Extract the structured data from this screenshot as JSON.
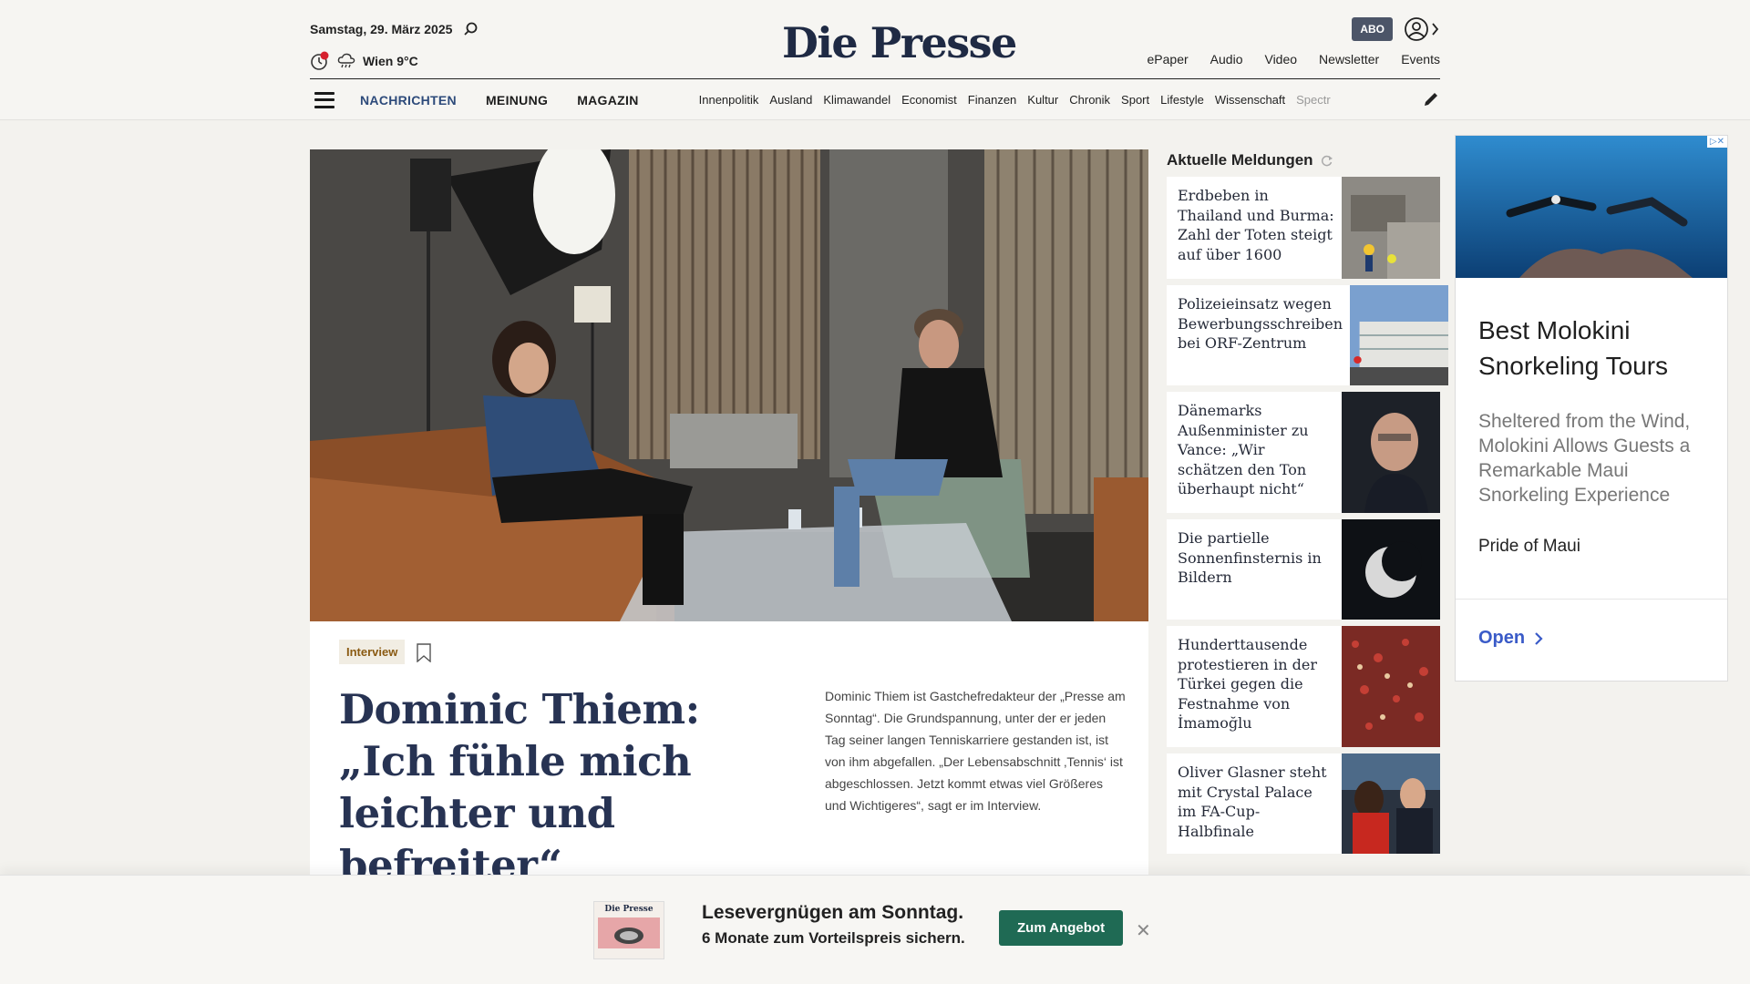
{
  "header": {
    "date": "Samstag, 29. März 2025",
    "weather": "Wien 9°C",
    "logo": "Die Presse",
    "abo": "ABO",
    "links": [
      "ePaper",
      "Audio",
      "Video",
      "Newsletter",
      "Events"
    ],
    "main_nav": [
      "NACHRICHTEN",
      "MEINUNG",
      "MAGAZIN"
    ],
    "sub_nav": [
      "Innenpolitik",
      "Ausland",
      "Klimawandel",
      "Economist",
      "Finanzen",
      "Kultur",
      "Chronik",
      "Sport",
      "Lifestyle",
      "Wissenschaft",
      "Spectr"
    ]
  },
  "hero": {
    "tag": "Interview",
    "headline": "Dominic Thiem: „Ich fühle mich leichter und befreiter“",
    "teaser": "Dominic Thiem ist Gastchefredakteur der „Presse am Sonntag“. Die Grundspannung, unter der er jeden Tag seiner langen Tenniskarriere gestanden ist, ist von ihm abgefallen. „Der Lebensabschnitt ‚Tennis‘ ist abgeschlossen. Jetzt kommt etwas viel Größeres und Wichtigeres“, sagt er im Interview."
  },
  "news": {
    "title": "Aktuelle Meldungen",
    "items": [
      {
        "text": "Erdbeben in Thailand und Burma: Zahl der Toten steigt auf über 1600",
        "image": "earthquake-rescue-photo"
      },
      {
        "text": "Polizeieinsatz wegen Bewerbungsschreiben bei ORF-Zentrum",
        "image": "orf-building-photo"
      },
      {
        "text": "Dänemarks Außenminister zu Vance: „Wir schätzen den Ton überhaupt nicht“",
        "image": "minister-portrait-photo"
      },
      {
        "text": "Die partielle Sonnenfinsternis in Bildern",
        "image": "solar-eclipse-photo"
      },
      {
        "text": "Hunderttausende protestieren in der Türkei gegen die Festnahme von İmamoğlu",
        "image": "protest-crowd-photo"
      },
      {
        "text": "Oliver Glasner steht mit Crystal Palace im FA-Cup-Halbfinale",
        "image": "football-coach-photo"
      }
    ]
  },
  "ad": {
    "title": "Best Molokini Snorkeling Tours",
    "description": "Sheltered from the Wind, Molokini Allows Guests a Remarkable Maui Snorkeling Experience",
    "brand": "Pride of Maui",
    "cta": "Open"
  },
  "promo": {
    "line1": "Lesevergnügen am Sonntag.",
    "line2": "6 Monate zum Vorteilspreis sichern.",
    "button": "Zum Angebot",
    "magazine_logo": "Die Presse"
  }
}
